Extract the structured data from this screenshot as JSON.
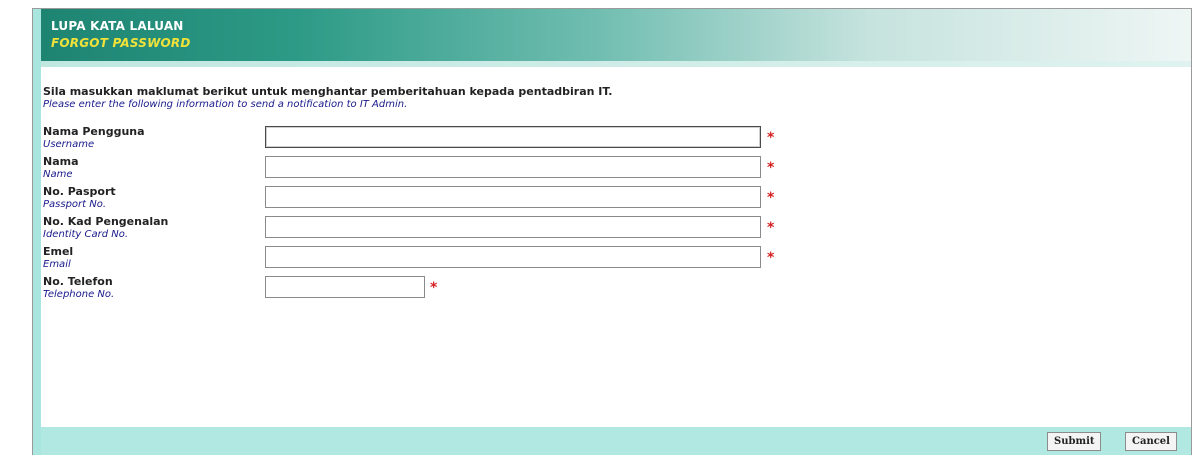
{
  "header": {
    "title_ms": "LUPA KATA LALUAN",
    "title_en": "FORGOT PASSWORD"
  },
  "intro": {
    "text_ms": "Sila masukkan maklumat berikut untuk menghantar pemberitahuan kepada pentadbiran IT.",
    "text_en": "Please enter the following information to send a notification to IT Admin."
  },
  "fields": [
    {
      "label_ms": "Nama Pengguna",
      "label_en": "Username",
      "value": "",
      "required": "*"
    },
    {
      "label_ms": "Nama",
      "label_en": "Name",
      "value": "",
      "required": "*"
    },
    {
      "label_ms": "No. Pasport",
      "label_en": "Passport No.",
      "value": "",
      "required": "*"
    },
    {
      "label_ms": "No. Kad Pengenalan",
      "label_en": "Identity Card No.",
      "value": "",
      "required": "*"
    },
    {
      "label_ms": "Emel",
      "label_en": "Email",
      "value": "",
      "required": "*"
    },
    {
      "label_ms": "No. Telefon",
      "label_en": "Telephone No.",
      "value": "",
      "required": "*"
    }
  ],
  "buttons": {
    "submit_label": "Submit",
    "cancel_label": "Cancel"
  },
  "colors": {
    "header_dark": "#1e8472",
    "title_en": "#f1e23a",
    "required": "#d42020",
    "footer": "#b2e8e2"
  }
}
